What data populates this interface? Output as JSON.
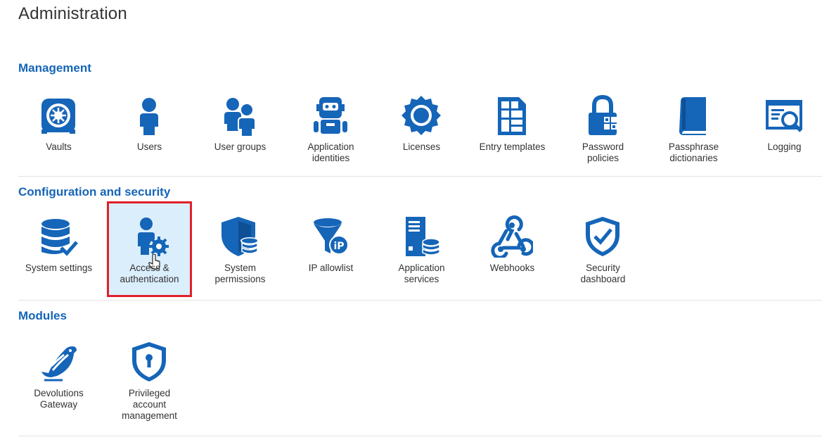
{
  "page": {
    "title": "Administration"
  },
  "sections": {
    "management": {
      "title": "Management",
      "items": [
        {
          "label": "Vaults",
          "icon": "vault-icon"
        },
        {
          "label": "Users",
          "icon": "user-icon"
        },
        {
          "label": "User groups",
          "icon": "user-groups-icon"
        },
        {
          "label": "Application\nidentities",
          "icon": "robot-icon"
        },
        {
          "label": "Licenses",
          "icon": "license-badge-icon"
        },
        {
          "label": "Entry templates",
          "icon": "entry-template-icon"
        },
        {
          "label": "Password\npolicies",
          "icon": "lock-policy-icon"
        },
        {
          "label": "Passphrase\ndictionaries",
          "icon": "book-icon"
        },
        {
          "label": "Logging",
          "icon": "log-search-icon"
        }
      ]
    },
    "configuration": {
      "title": "Configuration and security",
      "items": [
        {
          "label": "System settings",
          "icon": "database-check-icon"
        },
        {
          "label": "Access &\nauthentication",
          "icon": "user-gear-icon"
        },
        {
          "label": "System\npermissions",
          "icon": "shield-database-icon"
        },
        {
          "label": "IP allowlist",
          "icon": "ip-filter-icon"
        },
        {
          "label": "Application\nservices",
          "icon": "server-database-icon"
        },
        {
          "label": "Webhooks",
          "icon": "webhook-icon"
        },
        {
          "label": "Security\ndashboard",
          "icon": "shield-check-icon"
        }
      ]
    },
    "modules": {
      "title": "Modules",
      "items": [
        {
          "label": "Devolutions\nGateway",
          "icon": "gateway-bird-icon"
        },
        {
          "label": "Privileged\naccount\nmanagement",
          "icon": "shield-keyhole-icon"
        }
      ]
    }
  },
  "colors": {
    "accent": "#1565b8",
    "highlight": "#e0202a",
    "active_bg": "#dbeefc"
  }
}
